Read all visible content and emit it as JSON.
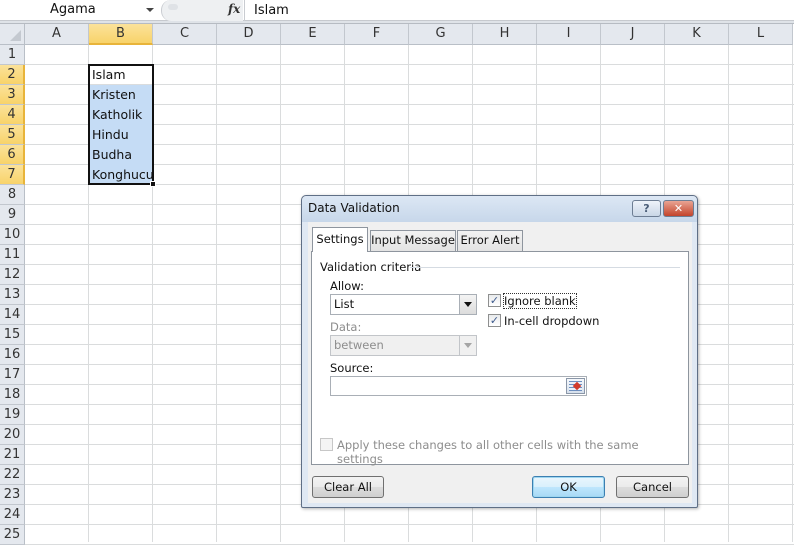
{
  "formula_bar": {
    "name_box": "Agama",
    "fx_label": "fx",
    "content": "Islam"
  },
  "columns": [
    "A",
    "B",
    "C",
    "D",
    "E",
    "F",
    "G",
    "H",
    "I",
    "J",
    "K",
    "L"
  ],
  "selected_column": "B",
  "rows": [
    "1",
    "2",
    "3",
    "4",
    "5",
    "6",
    "7",
    "8",
    "9",
    "10",
    "11",
    "12",
    "13",
    "14",
    "15",
    "16",
    "17",
    "18",
    "19",
    "20",
    "21",
    "22",
    "23",
    "24",
    "25"
  ],
  "selected_rows": [
    "2",
    "3",
    "4",
    "5",
    "6",
    "7"
  ],
  "cells": {
    "B2": "Islam",
    "B3": "Kristen",
    "B4": "Katholik",
    "B5": "Hindu",
    "B6": "Budha",
    "B7": "Konghucu"
  },
  "dialog": {
    "title": "Data Validation",
    "help_button": "?",
    "close_button": "✕",
    "tabs": [
      {
        "label": "Settings",
        "active": true
      },
      {
        "label": "Input Message",
        "active": false
      },
      {
        "label": "Error Alert",
        "active": false
      }
    ],
    "group_label": "Validation criteria",
    "allow_label": "Allow:",
    "allow_value": "List",
    "data_label": "Data:",
    "data_value": "between",
    "ignore_blank_label": "Ignore blank",
    "ignore_blank_checked": true,
    "in_cell_dropdown_label": "In-cell dropdown",
    "in_cell_dropdown_checked": true,
    "source_label": "Source:",
    "source_value": "",
    "apply_all_label": "Apply these changes to all other cells with the same settings",
    "apply_all_checked": false,
    "clear_all_button": "Clear All",
    "ok_button": "OK",
    "cancel_button": "Cancel"
  }
}
